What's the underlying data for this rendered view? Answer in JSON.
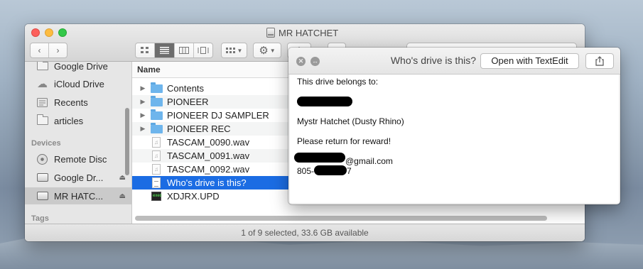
{
  "finder": {
    "title": "MR HATCHET",
    "sidebar": {
      "favorites": [
        {
          "label": "Google Drive",
          "icon": "folder-icon"
        },
        {
          "label": "iCloud Drive",
          "icon": "cloud-icon"
        },
        {
          "label": "Recents",
          "icon": "recents-icon"
        },
        {
          "label": "articles",
          "icon": "folder-icon"
        }
      ],
      "devices_header": "Devices",
      "devices": [
        {
          "label": "Remote Disc",
          "icon": "disc-icon"
        },
        {
          "label": "Google Dr...",
          "icon": "drive-icon"
        },
        {
          "label": "MR HATC...",
          "icon": "drive-icon"
        }
      ],
      "tags_header": "Tags"
    },
    "column_header": "Name",
    "files": [
      {
        "name": "Contents",
        "type": "folder"
      },
      {
        "name": "PIONEER",
        "type": "folder"
      },
      {
        "name": "PIONEER DJ SAMPLER",
        "type": "folder"
      },
      {
        "name": "PIONEER REC",
        "type": "folder"
      },
      {
        "name": "TASCAM_0090.wav",
        "type": "audio"
      },
      {
        "name": "TASCAM_0091.wav",
        "type": "audio"
      },
      {
        "name": "TASCAM_0092.wav",
        "type": "audio"
      },
      {
        "name": "Who's drive is this?",
        "type": "text",
        "selected": true
      },
      {
        "name": "XDJRX.UPD",
        "type": "exec"
      }
    ],
    "status": "1 of 9 selected, 33.6 GB available"
  },
  "quicklook": {
    "title": "Who's drive is this?",
    "open_button": "Open with TextEdit",
    "lines": {
      "l1": "This drive belongs to:",
      "l2": "Mystr Hatchet (Dusty Rhino)",
      "l3": "Please return for reward!",
      "email_suffix": "@gmail.com",
      "phone_prefix": "805-",
      "phone_suffix": "7"
    }
  },
  "colors": {
    "selection": "#1b6ce3",
    "folder": "#6eb5ec"
  }
}
